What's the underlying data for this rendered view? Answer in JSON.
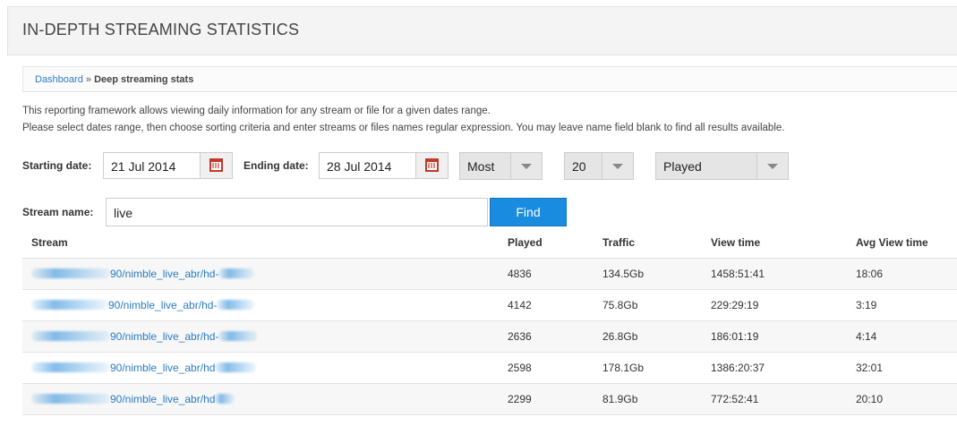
{
  "page": {
    "title": "IN-DEPTH STREAMING STATISTICS"
  },
  "breadcrumb": {
    "link": "Dashboard",
    "separator": " » ",
    "current": "Deep streaming stats"
  },
  "description": {
    "line1": "This reporting framework allows viewing daily information for any stream or file for a given dates range.",
    "line2": "Please select dates range, then choose sorting criteria and enter streams or files names regular expression. You may leave name field blank to find all results available."
  },
  "filters": {
    "start_label": "Starting date:",
    "start_value": "21 Jul 2014",
    "end_label": "Ending date:",
    "end_value": "28 Jul 2014",
    "order_value": "Most",
    "limit_value": "20",
    "metric_value": "Played",
    "name_label": "Stream name:",
    "name_value": "live",
    "find_label": "Find"
  },
  "table": {
    "headers": [
      "Stream",
      "Played",
      "Traffic",
      "View time",
      "Avg View time"
    ],
    "rows": [
      {
        "stream": "90/nimble_live_abr/hd-",
        "played": "4836",
        "traffic": "134.5Gb",
        "view_time": "1458:51:41",
        "avg_view_time": "18:06"
      },
      {
        "stream": "90/nimble_live_abr/hd-",
        "played": "4142",
        "traffic": "75.8Gb",
        "view_time": "229:29:19",
        "avg_view_time": "3:19"
      },
      {
        "stream": "90/nimble_live_abr/hd-",
        "played": "2636",
        "traffic": "26.8Gb",
        "view_time": "186:01:19",
        "avg_view_time": "4:14"
      },
      {
        "stream": "90/nimble_live_abr/hd",
        "played": "2598",
        "traffic": "178.1Gb",
        "view_time": "1386:20:37",
        "avg_view_time": "32:01"
      },
      {
        "stream": "90/nimble_live_abr/hd",
        "played": "2299",
        "traffic": "81.9Gb",
        "view_time": "772:52:41",
        "avg_view_time": "20:10"
      }
    ]
  },
  "icons": {
    "calendar": "calendar-icon",
    "dropdown": "dropdown-arrow-icon"
  },
  "colors": {
    "link": "#2a7cc4",
    "find_button": "#1a8ce0",
    "calendar": "#c0392b"
  }
}
